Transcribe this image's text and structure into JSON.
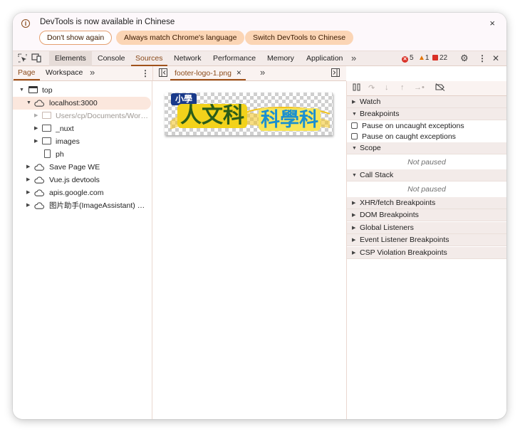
{
  "infobar": {
    "message": "DevTools is now available in Chinese",
    "buttons": [
      "Don't show again",
      "Always match Chrome's language",
      "Switch DevTools to Chinese"
    ],
    "close": "×"
  },
  "main_tabs": [
    "Elements",
    "Console",
    "Sources",
    "Network",
    "Performance",
    "Memory",
    "Application"
  ],
  "active_main_tab": "Sources",
  "more_tabs": "»",
  "status": {
    "errors": "5",
    "warnings": "1",
    "issues": "22"
  },
  "toolbar_glyphs": {
    "settings": "⚙",
    "menu": "⋮",
    "close": "✕",
    "kebab": "⋮"
  },
  "navigator": {
    "tabs": [
      "Page",
      "Workspace"
    ],
    "more": "»",
    "tree": [
      {
        "label": "top"
      },
      {
        "label": "localhost:3000"
      },
      {
        "label": "Users/cp/Documents/Work..."
      },
      {
        "label": "_nuxt"
      },
      {
        "label": "images"
      },
      {
        "label": "ph"
      },
      {
        "label": "Save Page WE"
      },
      {
        "label": "Vue.js devtools"
      },
      {
        "label": "apis.google.com"
      },
      {
        "label": "图片助手(ImageAssistant) 批..."
      }
    ]
  },
  "editor": {
    "open_file": "footer-logo-1.png",
    "close_glyph": "×",
    "more": "»",
    "logo_text": {
      "small": "小學",
      "left": "人文科",
      "right": "科學科"
    }
  },
  "debugger": {
    "sections": [
      "Watch",
      "Breakpoints",
      "Scope",
      "Call Stack",
      "XHR/fetch Breakpoints",
      "DOM Breakpoints",
      "Global Listeners",
      "Event Listener Breakpoints",
      "CSP Violation Breakpoints"
    ],
    "breakpoint_options": [
      "Pause on uncaught exceptions",
      "Pause on caught exceptions"
    ],
    "not_paused": "Not paused"
  },
  "colors": {
    "accent": "#a0521a",
    "tab_bar": "#f3ebe9",
    "selected_row": "#fbe7dd",
    "error": "#d93025",
    "warning": "#e37400"
  },
  "icons": [
    "info-icon",
    "inspect-icon",
    "device-toolbar-icon",
    "error-icon",
    "warning-icon",
    "issues-icon",
    "gear-icon",
    "kebab-menu-icon",
    "close-icon",
    "frame-icon",
    "cloud-icon",
    "folder-icon",
    "file-icon",
    "toggle-sidebar-icon",
    "pause-icon",
    "step-over-icon",
    "step-into-icon",
    "step-out-icon",
    "step-icon",
    "deactivate-breakpoints-icon"
  ]
}
